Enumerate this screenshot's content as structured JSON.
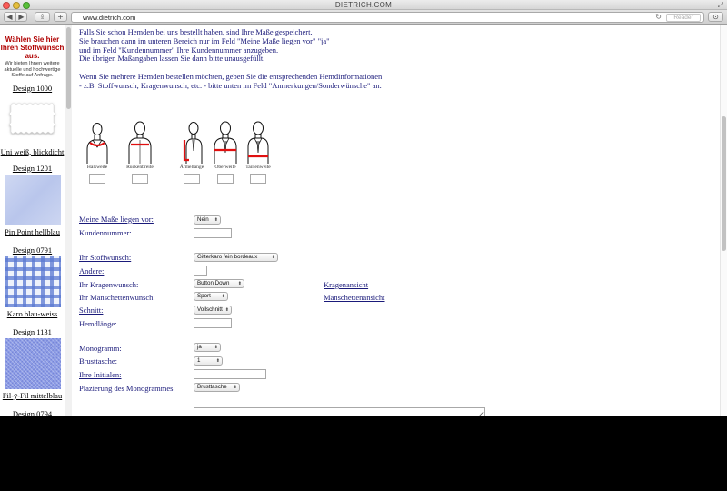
{
  "browser": {
    "window_title": "DIETRICH.COM",
    "url": "www.dietrich.com",
    "reader_label": "Reader",
    "back_glyph": "◀",
    "forward_glyph": "▶",
    "share_glyph": "⇪",
    "new_tab_glyph": "+",
    "reload_glyph": "↻",
    "download_glyph": "⊙",
    "colors": {
      "close": "#fc5b57",
      "minimize": "#e5bf3c",
      "zoom": "#57c038"
    }
  },
  "sidebar": {
    "heading": "Wählen Sie hier Ihren Stoffwunsch aus.",
    "subtext": "Wir bieten Ihnen weitere aktuelle und hochwertige Stoffe auf Anfrage.",
    "designs": [
      {
        "label": "Design 1000",
        "name": "Uni weiß, blickdicht",
        "swatch": "white"
      },
      {
        "label": "Design 1201",
        "name": "Pin Point hellblau",
        "swatch": "lightblue"
      },
      {
        "label": "Design 0791",
        "name": "Karo blau-weiss",
        "swatch": "check"
      },
      {
        "label": "Design 1131",
        "name": "Fil-ȳ-Fil mittelblau",
        "swatch": "filfil"
      },
      {
        "label": "Design 0794",
        "name": "",
        "swatch": "none"
      }
    ]
  },
  "intro": {
    "lines1": [
      "Falls Sie schon Hemden bei uns bestellt haben, sind Ihre Maße gespeichert.",
      "Sie brauchen dann im unteren Bereich nur im Feld \"Meine Maße liegen vor\" \"ja\"",
      "und im Feld \"Kundennummer\" Ihre Kundennummer anzugeben.",
      "Die übrigen Maßangaben lassen Sie dann bitte unausgefüllt."
    ],
    "lines2": [
      "Wenn Sie mehrere Hemden bestellen möchten, geben Sie die entsprechenden Hemdinformationen",
      "- z.B. Stoffwunsch, Kragenwunsch, etc. - bitte unten im Feld \"Anmerkungen/Sonderwünsche\" an."
    ]
  },
  "measurements": [
    {
      "label": "Halsweite"
    },
    {
      "label": "Rückenbreite"
    },
    {
      "label": "Ärmellänge"
    },
    {
      "label": "Oberweite"
    },
    {
      "label": "Taillenweite"
    }
  ],
  "form": {
    "masse_label": "Meine Maße liegen vor:",
    "masse_value": "Nein",
    "kundennummer_label": "Kundennummer:",
    "stoff_label": "Ihr Stoffwunsch:",
    "stoff_value": "Gitterkaro fein bordeaux",
    "andere_label": "Andere:",
    "kragen_label": "Ihr Kragenwunsch:",
    "kragen_value": "Button Down",
    "kragen_link": "Kragenansicht",
    "manschetten_label": "Ihr Manschettenwunsch:",
    "manschetten_value": "Sport",
    "manschetten_link": "Manschettenansicht",
    "schnitt_label": "Schnitt:",
    "schnitt_value": "Vollschnitt",
    "hemdlaenge_label": "Hemdlänge:",
    "monogramm_label": "Monogramm:",
    "monogramm_value": "ja",
    "brusttasche_label": "Brusttasche:",
    "brusttasche_value": "1",
    "initialen_label": "Ihre Initialen:",
    "platzierung_label": "Plazierung des Monogrammes:",
    "platzierung_value": "Brusttasche",
    "select_arrow": "⬍",
    "accent_color": "#1a1a7a",
    "measure_color": "#e01010"
  }
}
